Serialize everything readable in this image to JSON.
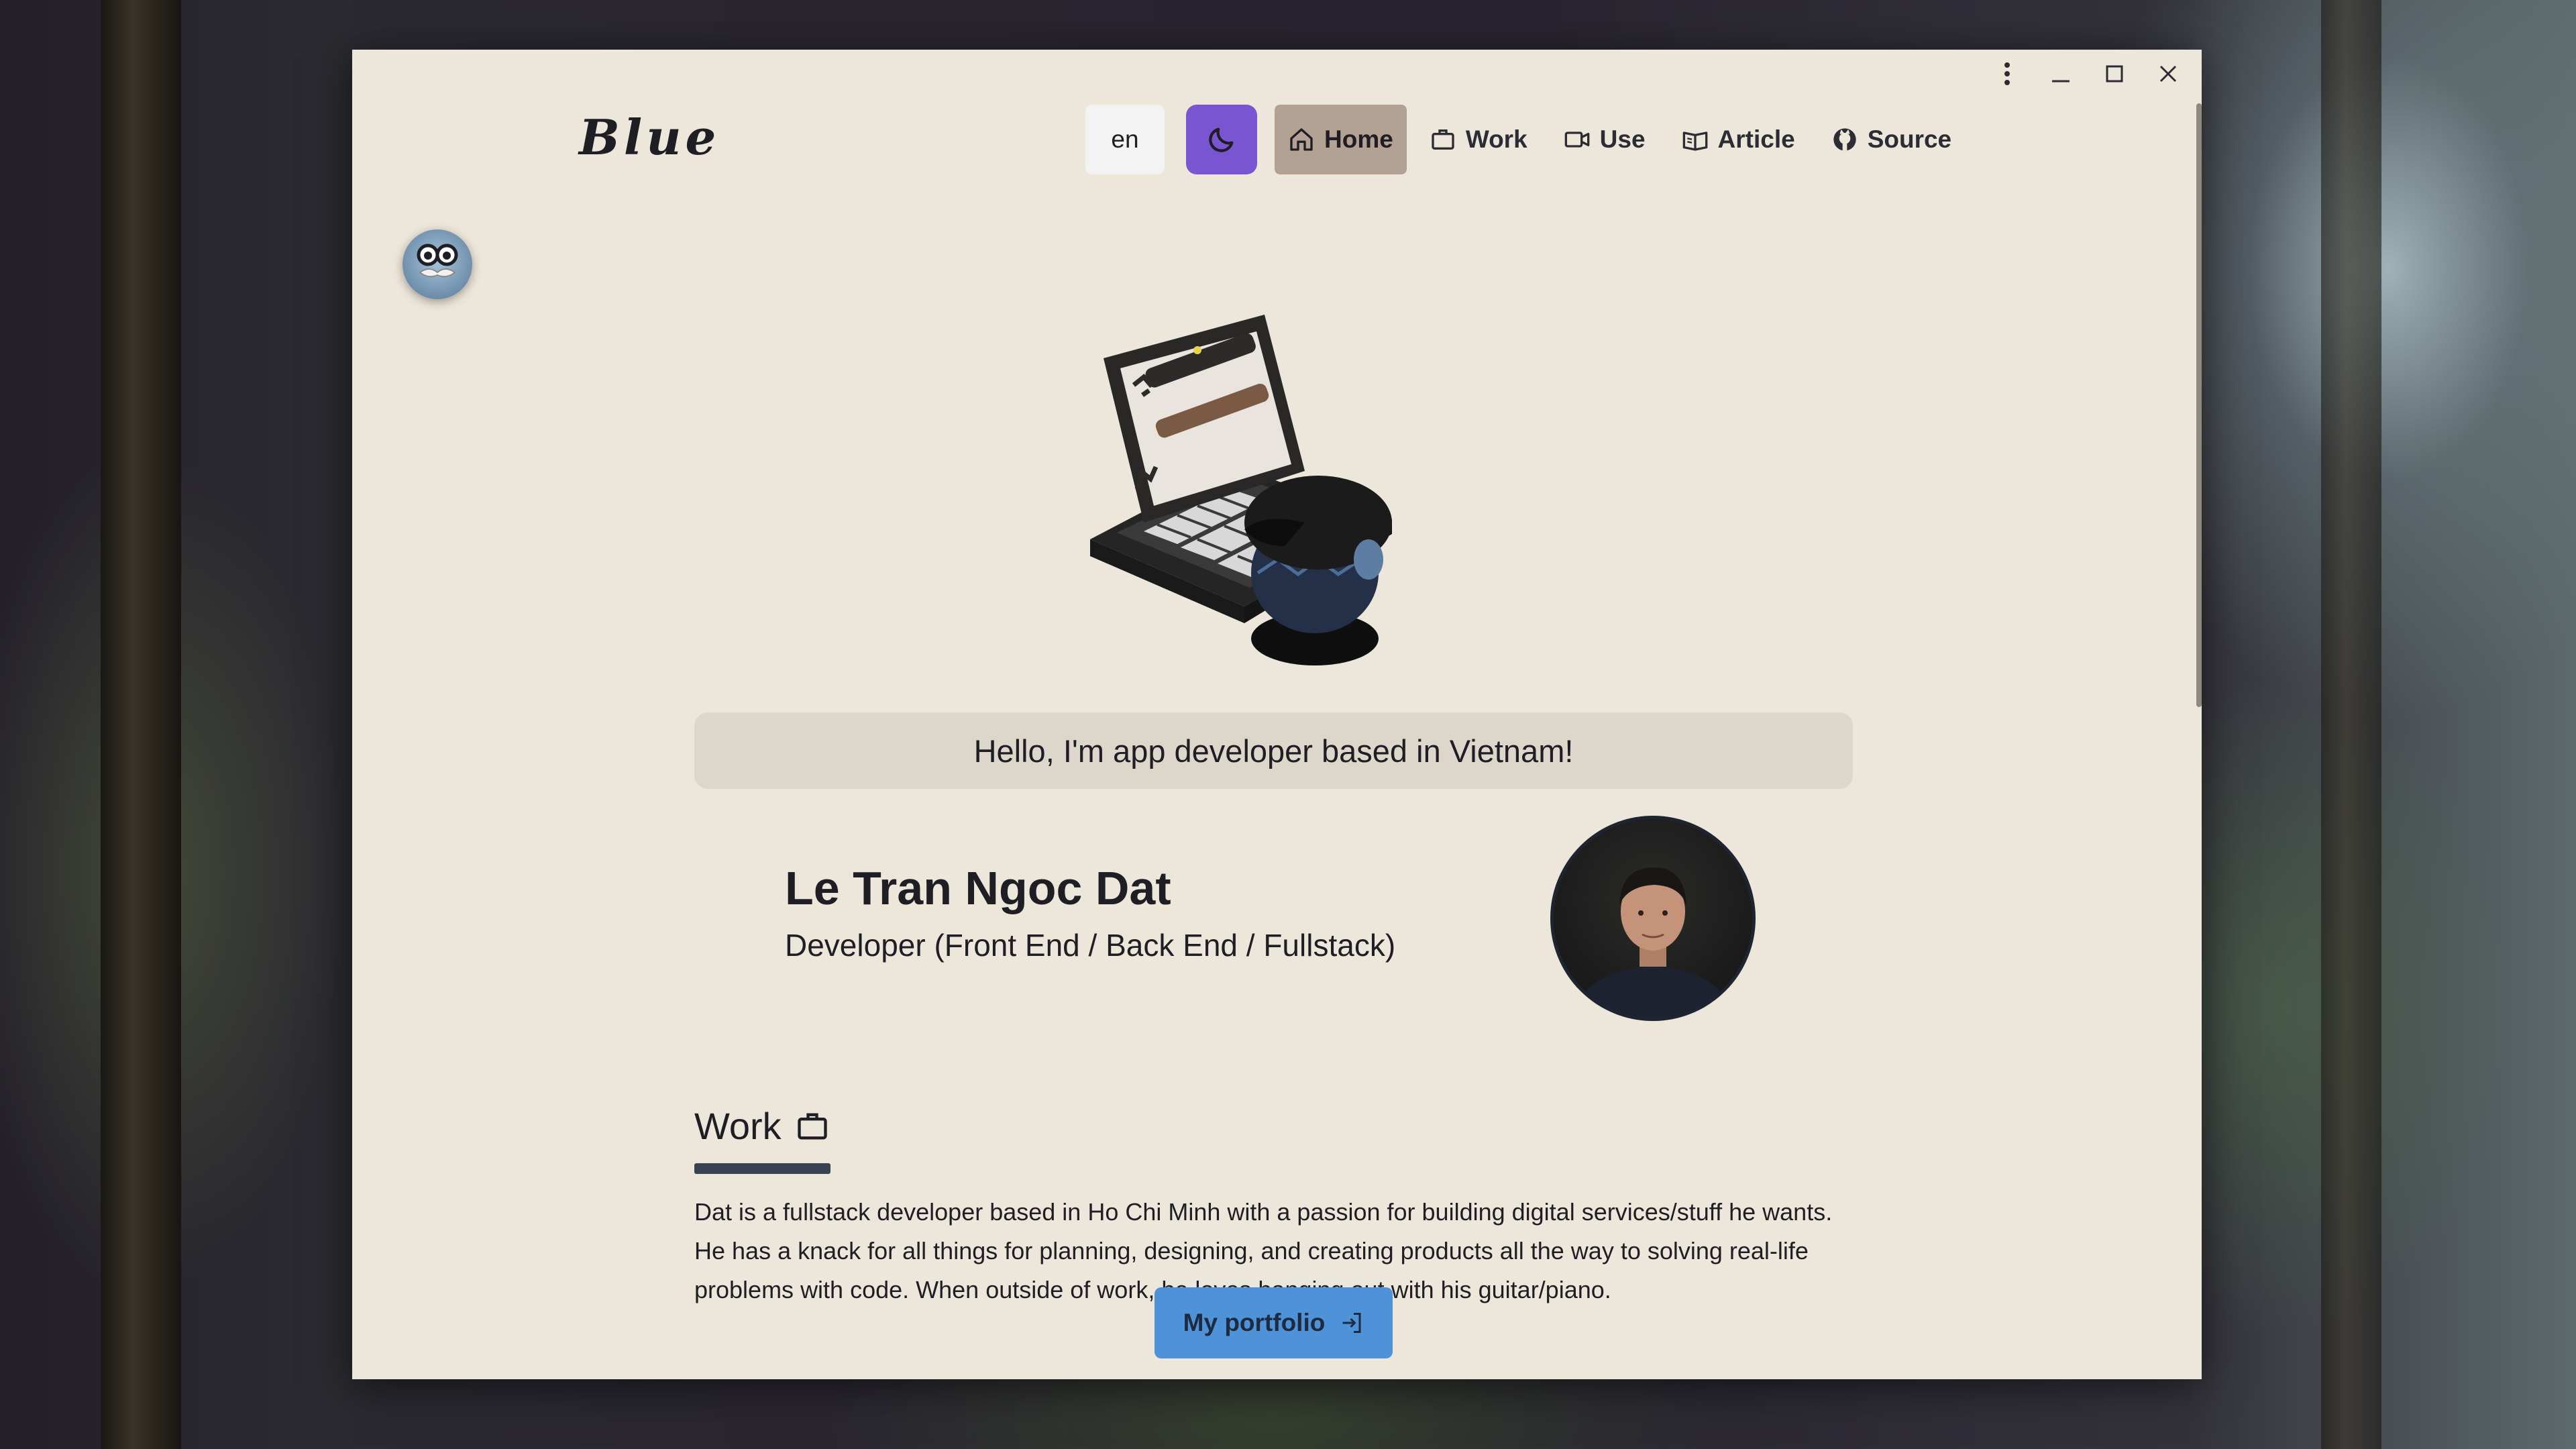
{
  "window": {
    "controls": [
      "more-vert-icon",
      "minimize-icon",
      "maximize-icon",
      "close-icon"
    ]
  },
  "header": {
    "logo": "Blue",
    "lang_label": "en",
    "theme_icon": "moon-icon",
    "nav": [
      {
        "label": "Home",
        "icon": "home-icon",
        "active": true
      },
      {
        "label": "Work",
        "icon": "briefcase-icon"
      },
      {
        "label": "Use",
        "icon": "video-icon"
      },
      {
        "label": "Article",
        "icon": "newspaper-icon"
      },
      {
        "label": "Source",
        "icon": "github-icon"
      }
    ]
  },
  "hero": {
    "illustration": "laptop-with-cap-illustration"
  },
  "greeting": "Hello, I'm app developer based in Vietnam!",
  "profile": {
    "name": "Le Tran Ngoc Dat",
    "role": "Developer (Front End / Back End / Fullstack)"
  },
  "work_section": {
    "title": "Work",
    "description": "Dat is a fullstack developer based in Ho Chi Minh with a passion for building digital services/stuff he wants. He has a knack for all things for planning, designing, and creating products all the way to solving real-life problems with code. When outside of work, he loves hanging out with his guitar/piano.",
    "button_label": "My portfolio"
  },
  "colors": {
    "page_bg": "#ede6da",
    "accent_purple": "#7a55d1",
    "active_nav": "#b3a293",
    "button_blue": "#4e93d8"
  }
}
